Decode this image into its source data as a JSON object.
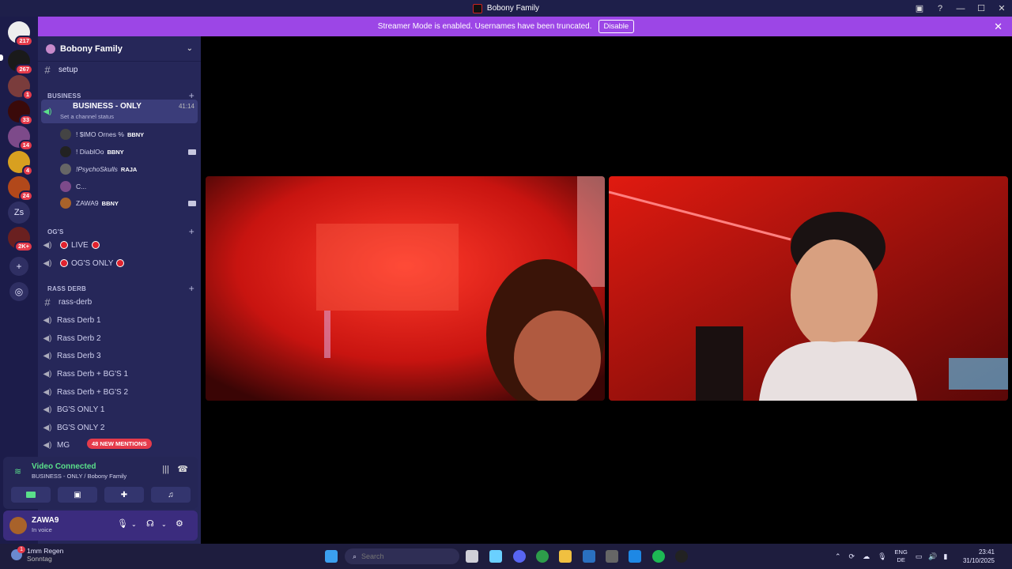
{
  "window": {
    "title": "Bobony Family"
  },
  "banner": {
    "text": "Streamer Mode is enabled. Usernames have been truncated.",
    "disable_label": "Disable"
  },
  "rail": {
    "badges": [
      "217",
      "267",
      "1",
      "33",
      "14",
      "4",
      "24",
      "2K+"
    ],
    "zs_label": "Zs"
  },
  "server": {
    "name": "Bobony Family"
  },
  "channels": {
    "setup": "setup",
    "cat_business": "BUSINESS",
    "business_only": "BUSINESS - ONLY",
    "business_timer": "41:14",
    "business_status": "Set a channel status",
    "cat_ogs": "OG'S",
    "live": "LIVE",
    "ogs_only": "OG'S ONLY",
    "cat_rass": "RASS DERB",
    "rass_derb_text": "rass-derb",
    "rass1": "Rass Derb 1",
    "rass2": "Rass Derb 2",
    "rass3": "Rass Derb 3",
    "rass_bg1": "Rass Derb + BG'S 1",
    "rass_bg2": "Rass Derb + BG'S 2",
    "bgs1": "BG'S ONLY 1",
    "bgs2": "BG'S ONLY 2",
    "mg": "MG"
  },
  "members": [
    {
      "name": "! $IMO Ornes %",
      "tag": "BBNY"
    },
    {
      "name": "! DiablOo",
      "tag": "BBNY"
    },
    {
      "name": "!PsychoSkulls",
      "tag": "RAJA"
    },
    {
      "name": "C...",
      "tag": ""
    },
    {
      "name": "ZAWA9",
      "tag": "BBNY"
    }
  ],
  "mentions": "48 NEW MENTIONS",
  "voice": {
    "status": "Video Connected",
    "channel": "BUSINESS - ONLY / Bobony Family"
  },
  "user": {
    "name": "ZAWA9",
    "status": "In voice"
  },
  "taskbar": {
    "weather_badge": "1",
    "weather": "1mm Regen",
    "weather_day": "Sonntag",
    "search_placeholder": "Search",
    "lang1": "ENG",
    "lang2": "DE",
    "time": "23:41",
    "date": "31/10/2025"
  },
  "colors": {
    "accent": "#9c46e6",
    "rail_bg": "#1c1c4a",
    "sidebar_bg": "#262759",
    "mention_red": "#e53b4b",
    "connected_green": "#5ae08a"
  }
}
